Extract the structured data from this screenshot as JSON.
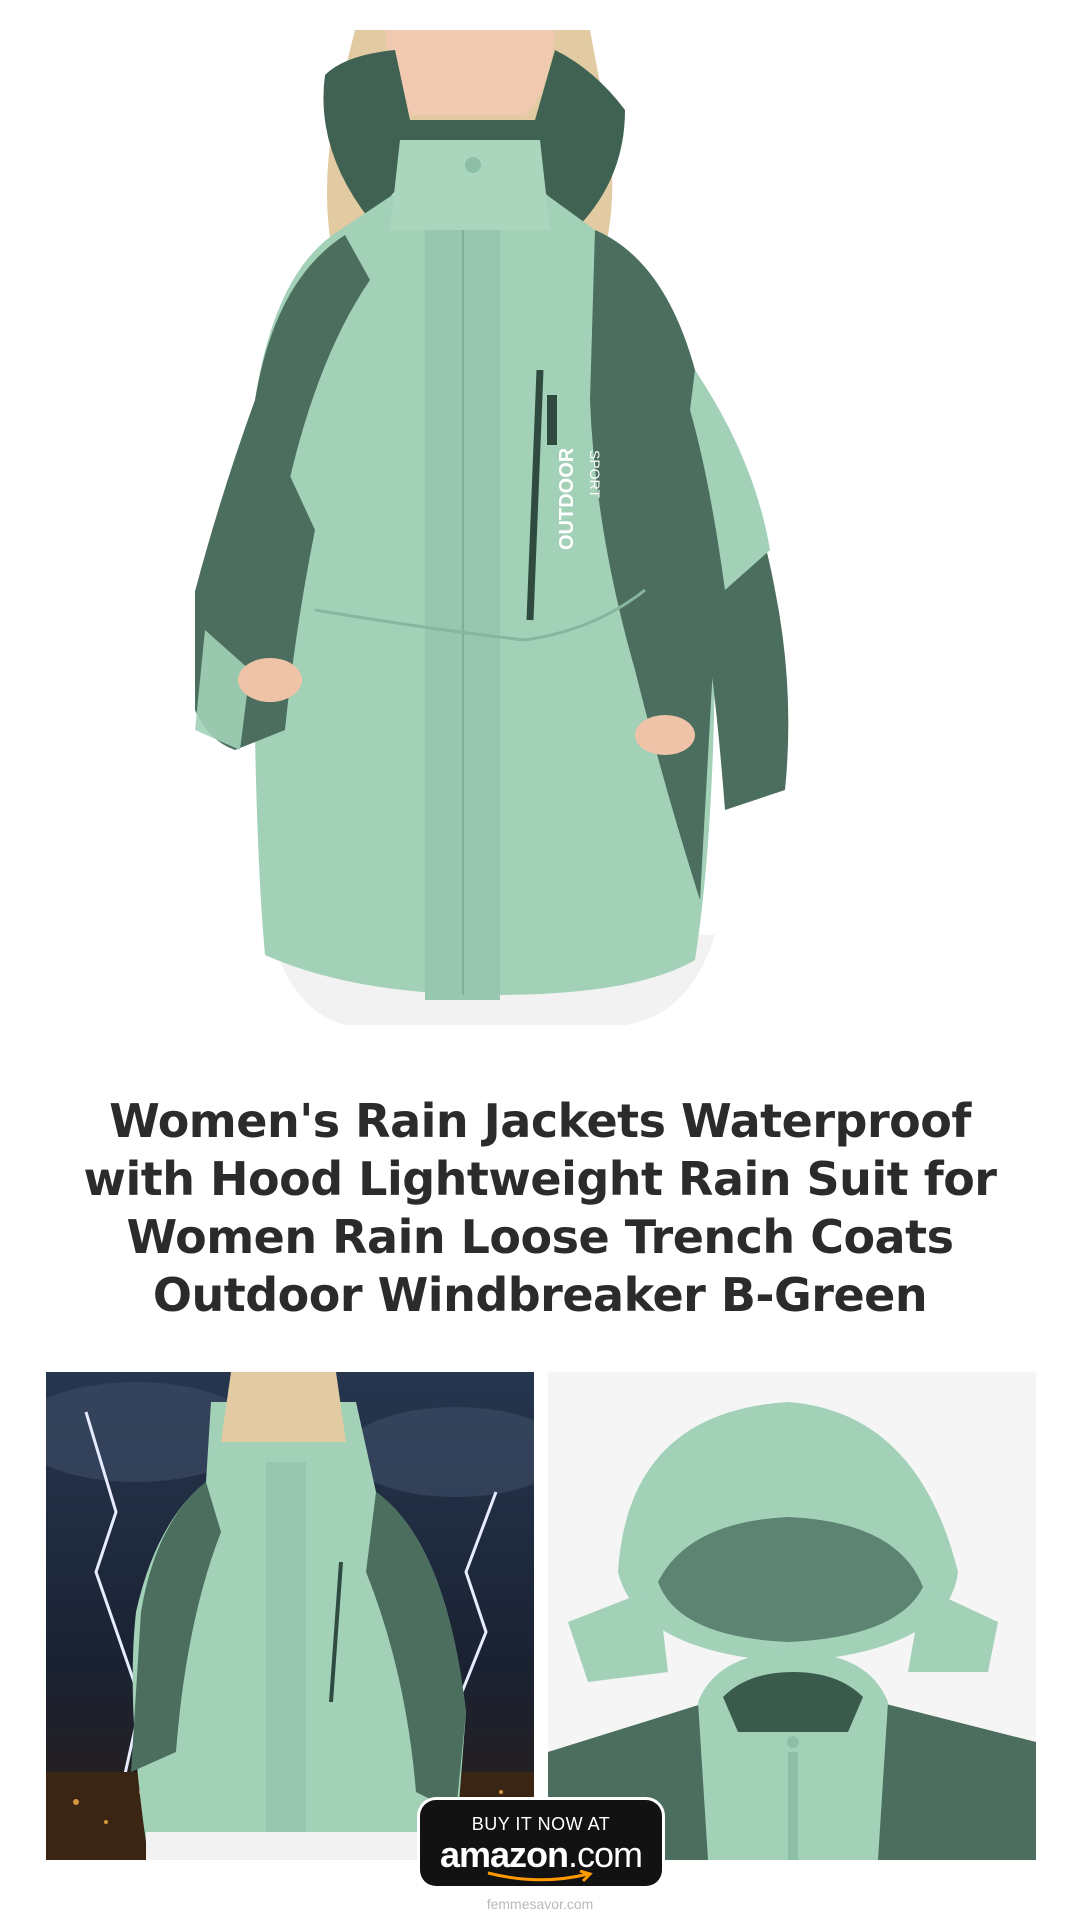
{
  "product": {
    "title": "Women's Rain Jackets Waterproof with Hood Lightweight Rain Suit for Women Rain Loose Trench Coats Outdoor Windbreaker B-Green",
    "jacket_print_brand": "OUTDOOR",
    "jacket_print_sub": "SPORT"
  },
  "cta": {
    "line1": "BUY IT NOW AT",
    "brand": "amazon",
    "tld": ".com",
    "icon": "amazon-smile-icon"
  },
  "footer": {
    "site": "femmesavor.com"
  },
  "colors": {
    "jacket_light": "#9fcfb5",
    "jacket_dark": "#4b6e5f",
    "title_text": "#2b2b2b",
    "badge_bg": "#121212",
    "amazon_orange": "#ff9900"
  }
}
